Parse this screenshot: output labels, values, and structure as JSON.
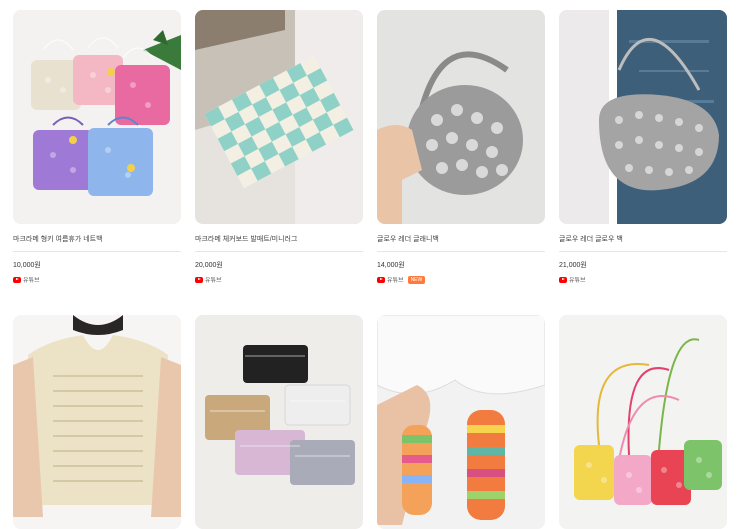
{
  "products": [
    {
      "title": "마크라메 형키 여름휴가 네트백",
      "price": "10,000원",
      "channel": "유튜브",
      "badge": "",
      "image": "pastel-net-bags"
    },
    {
      "title": "마크라메 체커보드 발매트/미니러그",
      "price": "20,000원",
      "channel": "유튜브",
      "badge": "",
      "image": "checkerboard-rug"
    },
    {
      "title": "글로우 레더 글래니백",
      "price": "14,000원",
      "channel": "유튜브",
      "badge": "NEW",
      "image": "silver-net-bag"
    },
    {
      "title": "글로우 레더 글로우 백",
      "price": "21,000원",
      "channel": "유튜브",
      "badge": "",
      "image": "silver-shoulder-bag"
    },
    {
      "title": "",
      "price": "",
      "channel": "",
      "badge": "",
      "image": "cream-knit-vest"
    },
    {
      "title": "",
      "price": "",
      "channel": "",
      "badge": "",
      "image": "ruffle-pouches"
    },
    {
      "title": "",
      "price": "",
      "channel": "",
      "badge": "",
      "image": "striped-socks"
    },
    {
      "title": "",
      "price": "",
      "channel": "",
      "badge": "",
      "image": "colorful-mini-bags"
    }
  ]
}
